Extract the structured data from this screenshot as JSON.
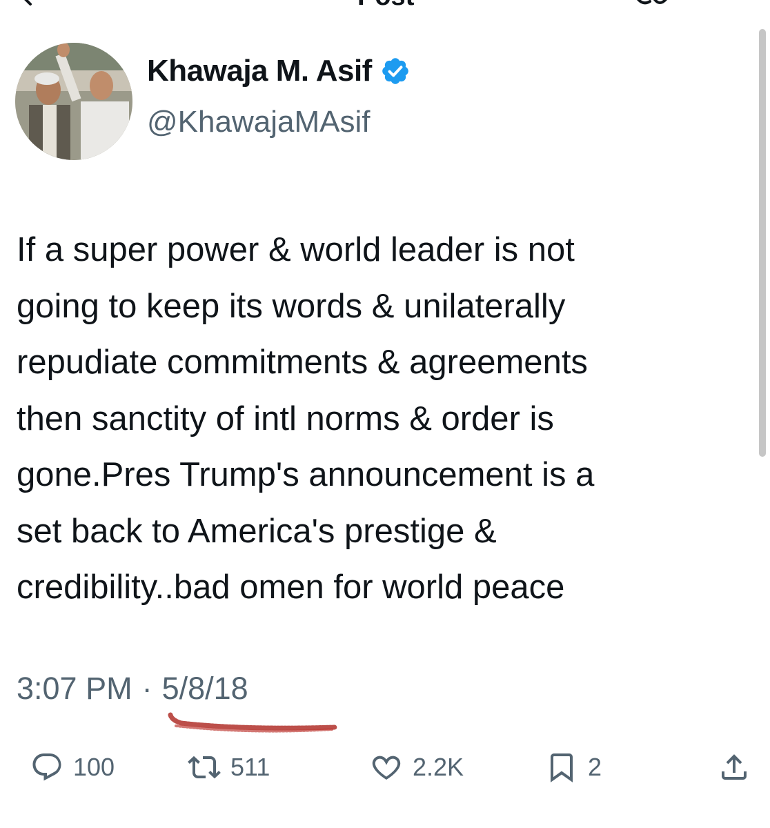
{
  "header": {
    "title": "Post",
    "back_icon": "back-arrow-icon",
    "more_icon": "more-icon"
  },
  "author": {
    "display_name": "Khawaja M. Asif",
    "handle": "@KhawajaMAsif",
    "verified_color": "#1d9bf0"
  },
  "tweet": {
    "text": "If a super power & world leader is not\ngoing to keep its words & unilaterally\nrepudiate commitments & agreements\nthen sanctity of intl norms & order is\ngone.Pres Trump's announcement is a\nset back to America's prestige &\ncredibility..bad omen for world peace",
    "time": "3:07 PM",
    "separator": "·",
    "date": "5/8/18"
  },
  "actions": {
    "replies": "100",
    "reposts": "511",
    "likes": "2.2K",
    "bookmarks": "2"
  },
  "colors": {
    "text": "#0f1419",
    "secondary": "#536471",
    "accent": "#1d9bf0",
    "annotation": "#b0302a"
  }
}
